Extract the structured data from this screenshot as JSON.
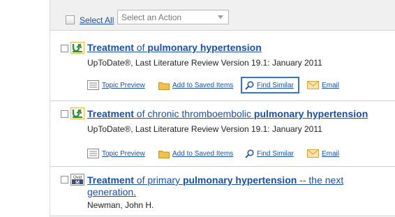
{
  "toolbar": {
    "select_all_label": "Select All",
    "action_select_value": "Select an Action"
  },
  "results": [
    {
      "title_parts": [
        {
          "text": "Treatment",
          "bold": true
        },
        {
          "text": " of ",
          "bold": false
        },
        {
          "text": "pulmonary hypertension",
          "bold": true
        }
      ],
      "source_icon": "uptodate-icon",
      "meta": "UpToDate®, Last Literature Review Version 19.1: January 2011",
      "actions": {
        "topic_preview": "Topic Preview",
        "add_saved": "Add to Saved Items",
        "find_similar": "Find Similar",
        "email": "Email"
      }
    },
    {
      "title_parts": [
        {
          "text": "Treatment",
          "bold": true
        },
        {
          "text": " of chronic thromboembolic ",
          "bold": false
        },
        {
          "text": "pulmonary hypertension",
          "bold": true
        }
      ],
      "source_icon": "uptodate-icon",
      "meta": "UpToDate®, Last Literature Review Version 19.1: January 2011",
      "actions": {
        "topic_preview": "Topic Preview",
        "add_saved": "Add to Saved Items",
        "find_similar": "Find Similar",
        "email": "Email"
      }
    },
    {
      "title_line1_parts": [
        {
          "text": "Treatment",
          "bold": true
        },
        {
          "text": " of primary ",
          "bold": false
        },
        {
          "text": "pulmonary hypertension",
          "bold": true
        },
        {
          "text": " -- the next",
          "bold": false
        }
      ],
      "title_line2": "generation.",
      "source_icon": "ovid-medline-icon",
      "source_icon_text_top": "Ovid",
      "source_icon_text_bottom": "M",
      "meta": "Newman, John H."
    }
  ],
  "colors": {
    "link": "#1a4fa3",
    "uptodate_green": "#2f8f3a",
    "folder": "#e8b23a",
    "highlight_border": "#3a73b8"
  }
}
